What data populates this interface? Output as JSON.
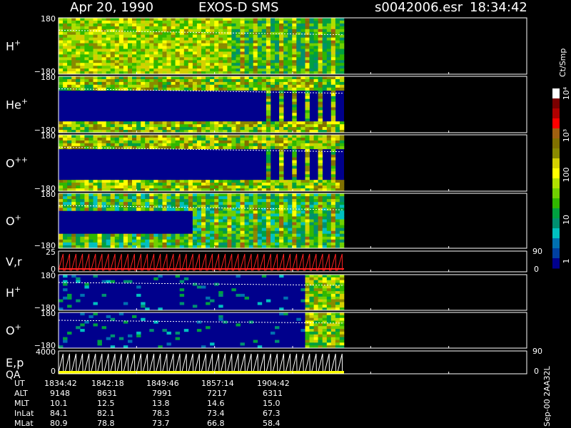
{
  "header": {
    "date": "Apr 20, 1990",
    "instrument": "EXOS-D SMS",
    "file": "s0042006.esr",
    "time": "18:34:42"
  },
  "colorbar": {
    "unit": "Ct/Smp",
    "ticks": [
      "10⁴",
      "10³",
      "100",
      "10",
      "1"
    ],
    "colors": [
      "#ffffff",
      "#7a0000",
      "#b00000",
      "#ff0000",
      "#a06010",
      "#807000",
      "#8a8a00",
      "#d4d000",
      "#ffff00",
      "#b0e000",
      "#70d000",
      "#30b800",
      "#00a040",
      "#009070",
      "#00c0c0",
      "#0070b0",
      "#0040a0",
      "#00008c"
    ]
  },
  "footer_id": "Sep-00 2AA32L",
  "chart_data": {
    "type": "heatmap",
    "panels": [
      {
        "id": "h-plus-pitch",
        "label": "H",
        "sup": "+",
        "ymax": "180",
        "ymin": "−180",
        "kind": "spectrogram"
      },
      {
        "id": "he-plus-pitch",
        "label": "He",
        "sup": "+",
        "ymax": "180",
        "ymin": "−180",
        "kind": "spectrogram"
      },
      {
        "id": "o-plus-plus-pitch",
        "label": "O",
        "sup": "++",
        "ymax": "180",
        "ymin": "−180",
        "kind": "spectrogram"
      },
      {
        "id": "o-plus-pitch",
        "label": "O",
        "sup": "+",
        "ymax": "180",
        "ymin": "−180",
        "kind": "spectrogram"
      },
      {
        "id": "v-r",
        "label": "V,r",
        "sup": "",
        "ymax": "25",
        "ymin": "0",
        "right_top": "90",
        "right_bottom": "0",
        "kind": "line"
      },
      {
        "id": "h-plus-2",
        "label": "H",
        "sup": "+",
        "ymax": "180",
        "ymin": "−180",
        "kind": "spectrogram"
      },
      {
        "id": "o-plus-2",
        "label": "O",
        "sup": "+",
        "ymax": "180",
        "ymin": "−180",
        "kind": "spectrogram"
      },
      {
        "id": "ep-qa",
        "label": "E,p",
        "label2": "QA",
        "sup": "",
        "ymax": "4000",
        "ymin": "0",
        "right_top": "90",
        "right_bottom": "0",
        "kind": "line"
      }
    ],
    "time_axis": {
      "rows": [
        {
          "name": "UT",
          "values": [
            "1834:42",
            "1842:18",
            "1849:46",
            "1857:14",
            "1904:42"
          ]
        },
        {
          "name": "ALT",
          "values": [
            "9148",
            "8631",
            "7991",
            "7217",
            "6311"
          ]
        },
        {
          "name": "MLT",
          "values": [
            "10.1",
            "12.5",
            "13.8",
            "14.6",
            "15.0"
          ]
        },
        {
          "name": "InLat",
          "values": [
            "84.1",
            "82.1",
            "78.3",
            "73.4",
            "67.3"
          ]
        },
        {
          "name": "MLat",
          "values": [
            "80.9",
            "78.8",
            "73.7",
            "66.8",
            "58.4"
          ]
        }
      ]
    }
  }
}
